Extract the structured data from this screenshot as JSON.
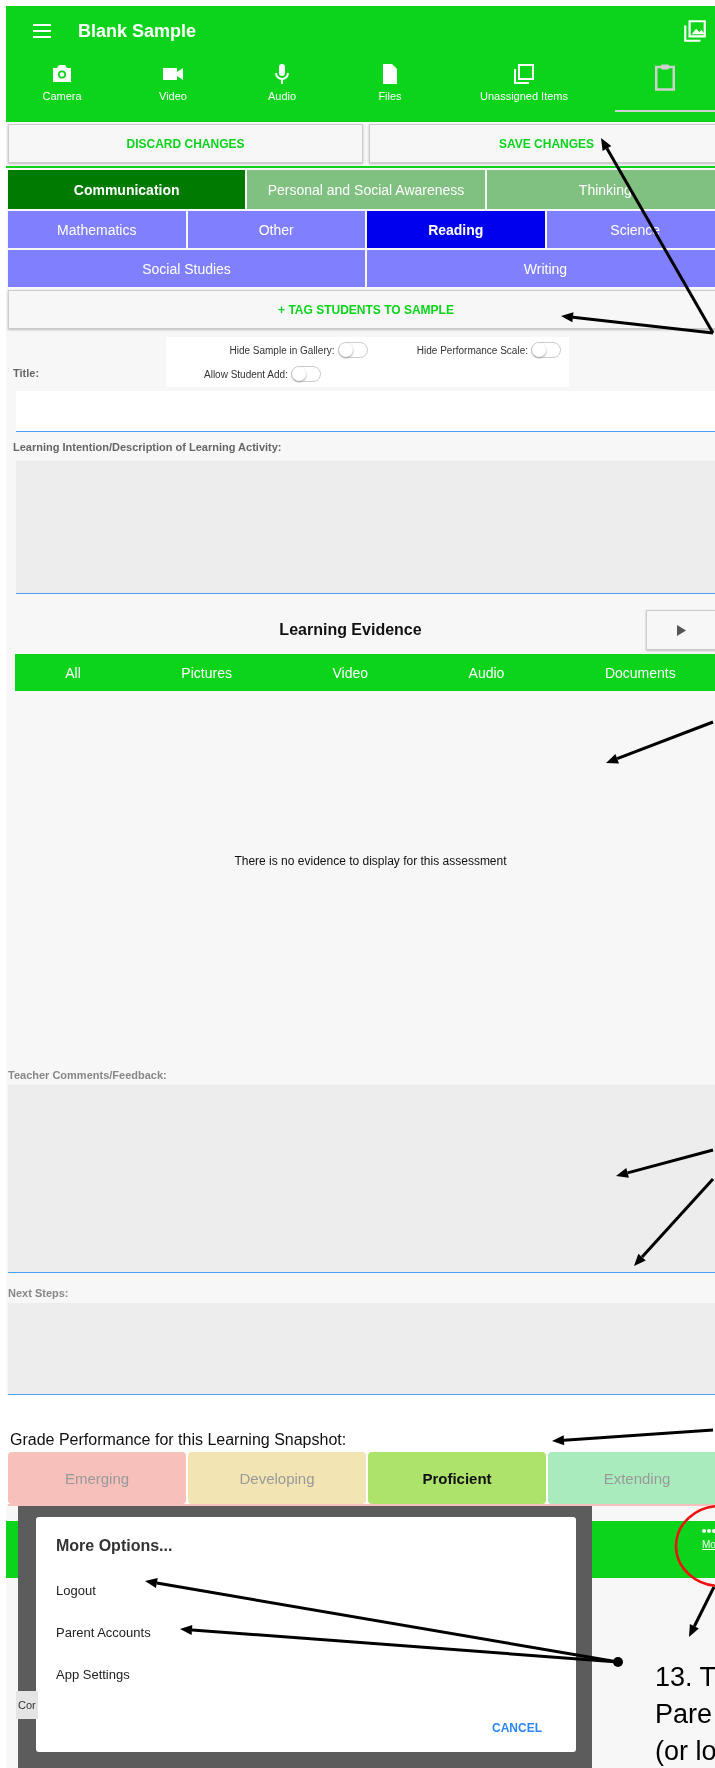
{
  "app_bar": {
    "title": "Blank Sample"
  },
  "media_tabs": [
    {
      "kind": "camera",
      "label": "Camera",
      "selected": false
    },
    {
      "kind": "video",
      "label": "Video",
      "selected": false
    },
    {
      "kind": "audio",
      "label": "Audio",
      "selected": false
    },
    {
      "kind": "files",
      "label": "Files",
      "selected": false
    },
    {
      "kind": "unassigned",
      "label": "Unassigned Items",
      "selected": false
    },
    {
      "kind": "clipboard",
      "selected": true
    }
  ],
  "actions": [
    "DISCARD CHANGES",
    "SAVE CHANGES"
  ],
  "competencies": [
    {
      "label": "Communication",
      "selected": true
    },
    {
      "label": "Personal and Social Awareness",
      "selected": false
    },
    {
      "label": "Thinking",
      "selected": false
    }
  ],
  "subjects": [
    {
      "label": "Mathematics",
      "selected": false
    },
    {
      "label": "Other",
      "selected": false
    },
    {
      "label": "Reading",
      "selected": true
    },
    {
      "label": "Science",
      "selected": false
    },
    {
      "label": "Social Studies",
      "selected": false
    },
    {
      "label": "Writing",
      "selected": false
    }
  ],
  "tag_button": "+ TAG STUDENTS TO SAMPLE",
  "toggles": [
    {
      "label": "Hide Sample in Gallery:",
      "on": false
    },
    {
      "label": "Hide Performance Scale:",
      "on": false
    },
    {
      "label": "Allow Student Add:",
      "on": false
    }
  ],
  "title_field": {
    "label": "Title:"
  },
  "description_field": {
    "label": "Learning Intention/Description of Learning Activity:"
  },
  "evidence": {
    "title": "Learning Evidence",
    "filters": [
      "All",
      "Pictures",
      "Video",
      "Audio",
      "Documents"
    ],
    "empty_message": "There is no evidence to display for this assessment"
  },
  "comments_field": {
    "label": "Teacher Comments/Feedback:"
  },
  "next_steps_field": {
    "label": "Next Steps:"
  },
  "grade": {
    "title": "Grade Performance for this Learning Snapshot:",
    "levels": [
      {
        "label": "Emerging",
        "selected": false,
        "color": "#f7c0bb"
      },
      {
        "label": "Developing",
        "selected": false,
        "color": "#f2e5b3"
      },
      {
        "label": "Proficient",
        "selected": true,
        "color": "#aee36b"
      },
      {
        "label": "Extending",
        "selected": false,
        "color": "#a9ebbd"
      }
    ]
  },
  "bottom_bar": {
    "more_label": "Mo"
  },
  "footer_text": "Cor",
  "dialog": {
    "title": "More Options...",
    "items": [
      "Logout",
      "Parent Accounts",
      "App Settings"
    ],
    "cancel": "CANCEL"
  },
  "annotation": {
    "lines": [
      "13. T",
      "Pare",
      "(or lo"
    ]
  }
}
